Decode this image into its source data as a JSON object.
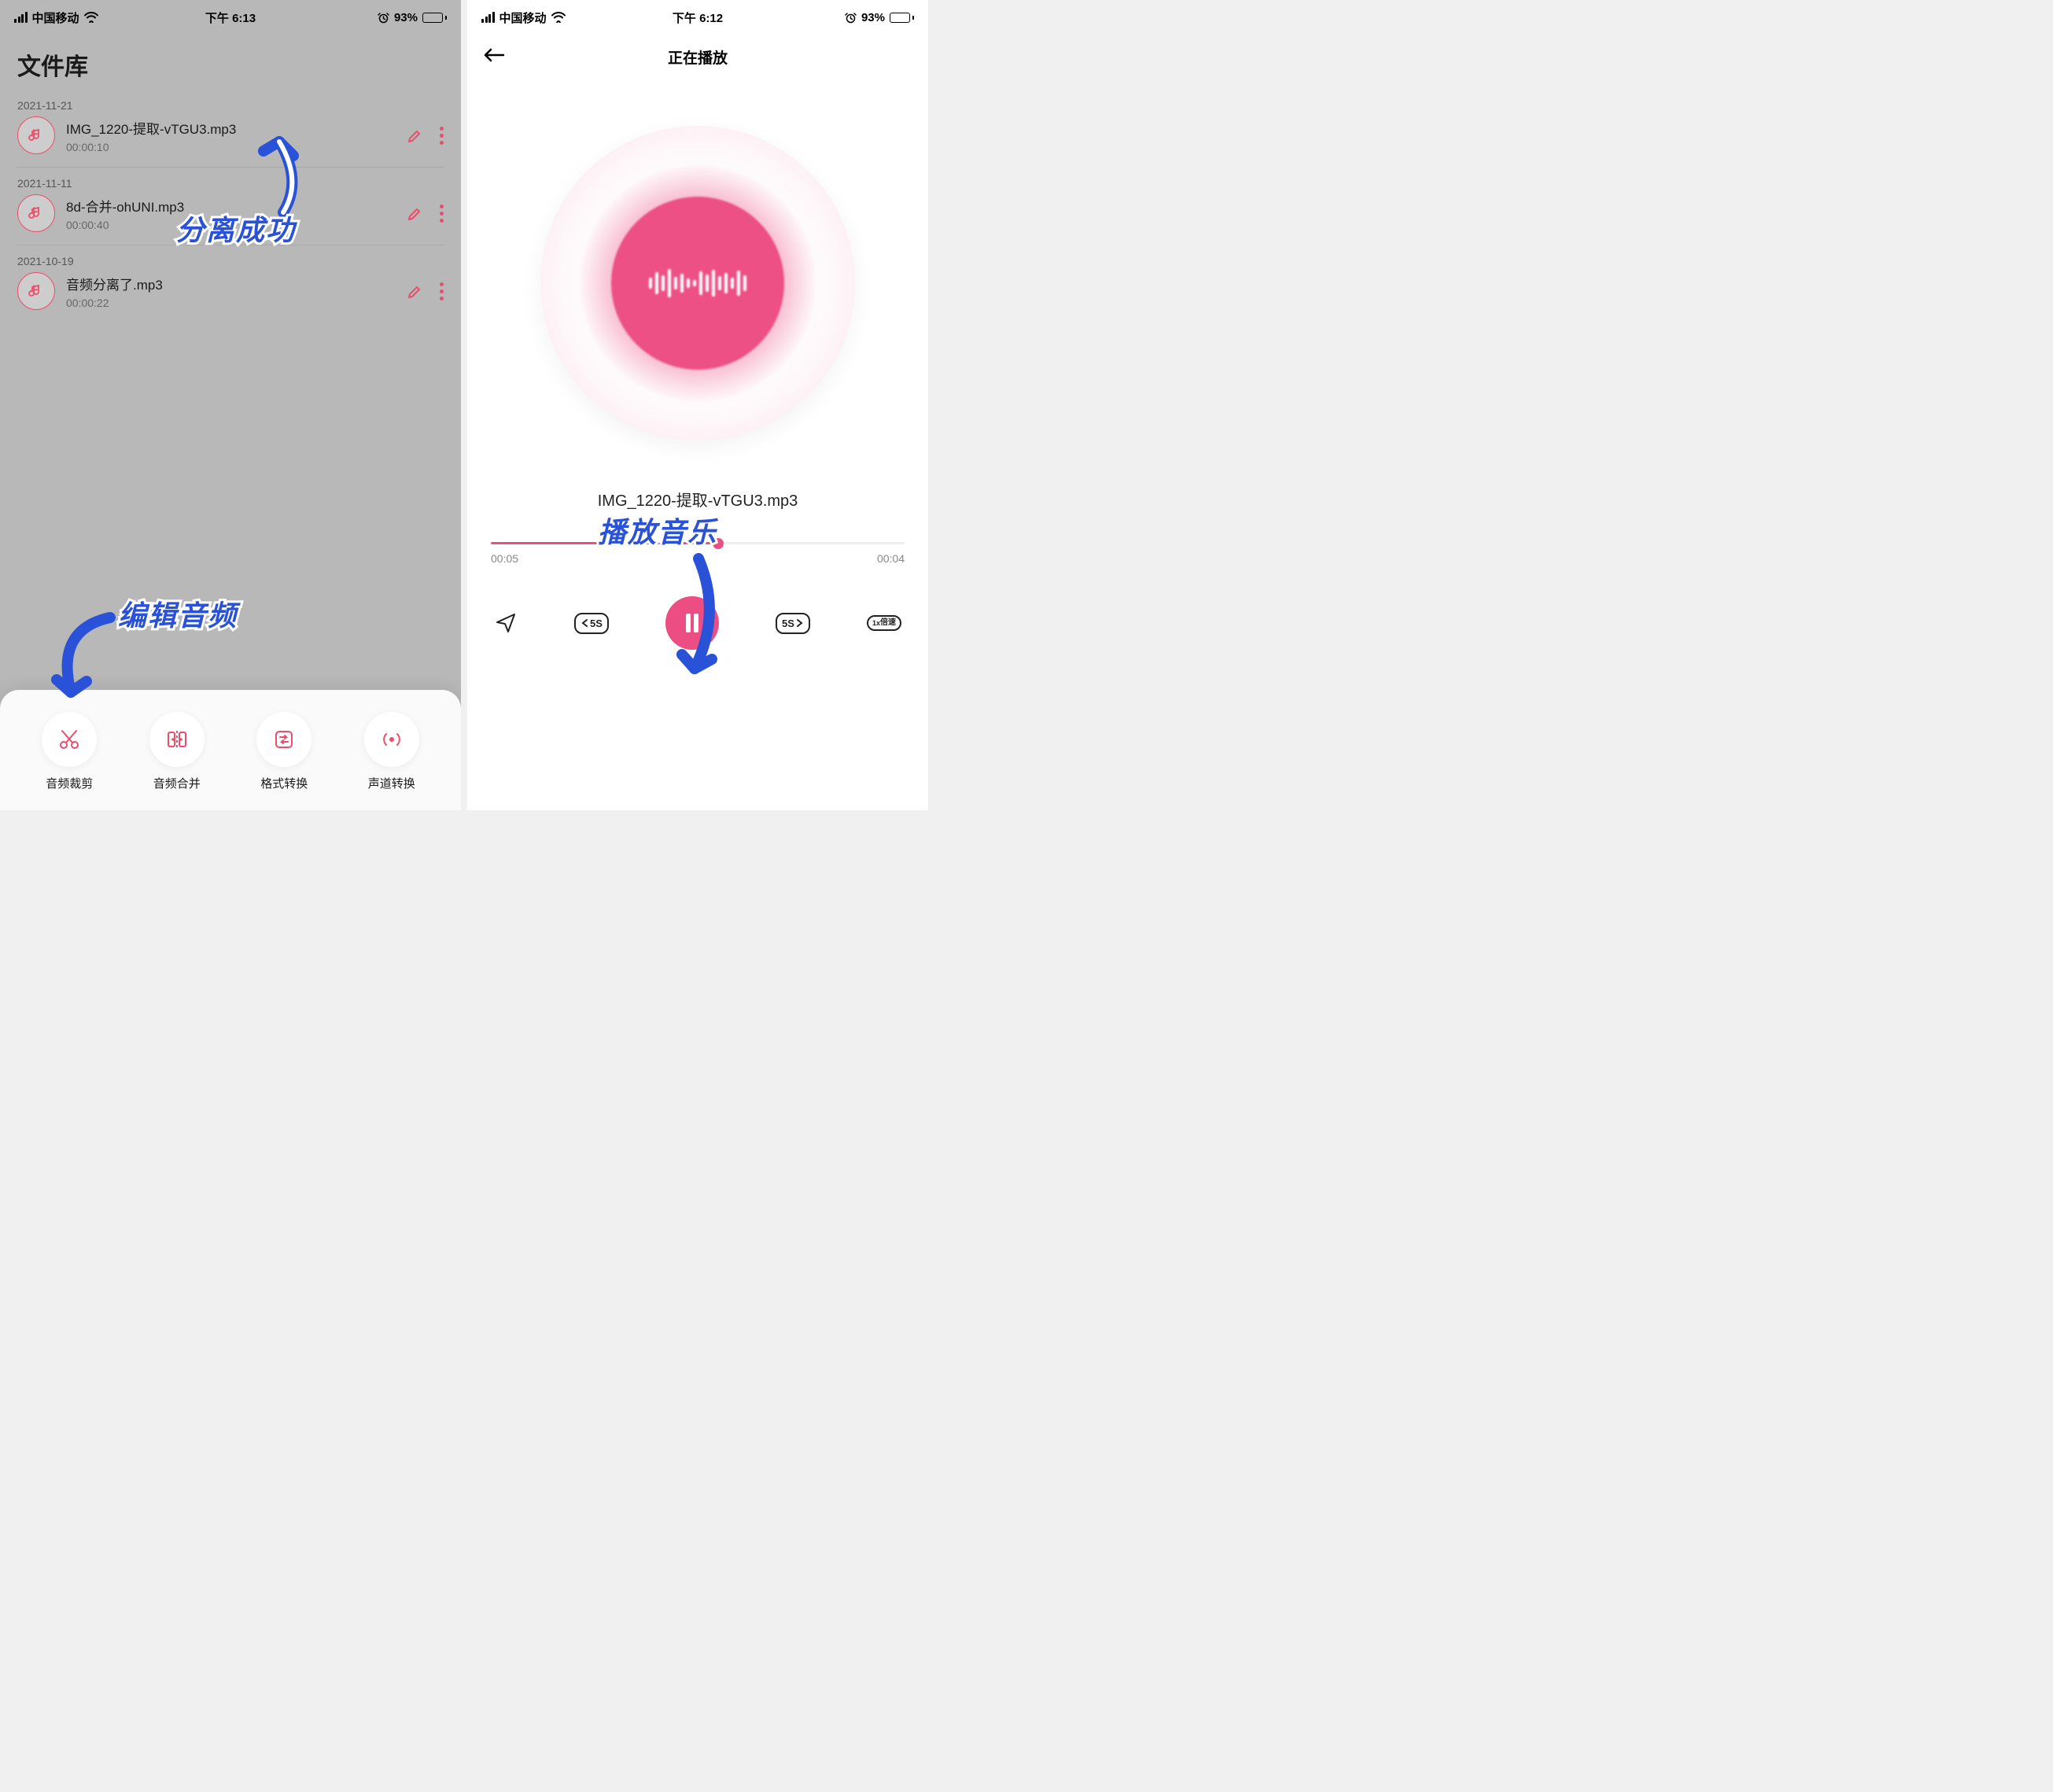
{
  "status": {
    "carrier": "中国移动",
    "time_left": "下午 6:13",
    "time_right": "下午 6:12",
    "battery_pct": "93%"
  },
  "library": {
    "title": "文件库",
    "items": [
      {
        "date": "2021-11-21",
        "name": "IMG_1220-提取-vTGU3.mp3",
        "duration": "00:00:10"
      },
      {
        "date": "2021-11-11",
        "name": "8d-合并-ohUNI.mp3",
        "duration": "00:00:40"
      },
      {
        "date": "2021-10-19",
        "name": "音频分离了.mp3",
        "duration": "00:00:22"
      }
    ]
  },
  "tools": [
    {
      "label": "音频裁剪"
    },
    {
      "label": "音频合并"
    },
    {
      "label": "格式转换"
    },
    {
      "label": "声道转换"
    }
  ],
  "player": {
    "title": "正在播放",
    "track_name": "IMG_1220-提取-vTGU3.mp3",
    "elapsed": "00:05",
    "remaining": "00:04",
    "skip_back": "5S",
    "skip_fwd": "5S",
    "speed_top": "1x",
    "speed_bottom": "倍速"
  },
  "annotations": {
    "separate": "分离成功",
    "edit": "编辑音频",
    "play": "播放音乐"
  }
}
